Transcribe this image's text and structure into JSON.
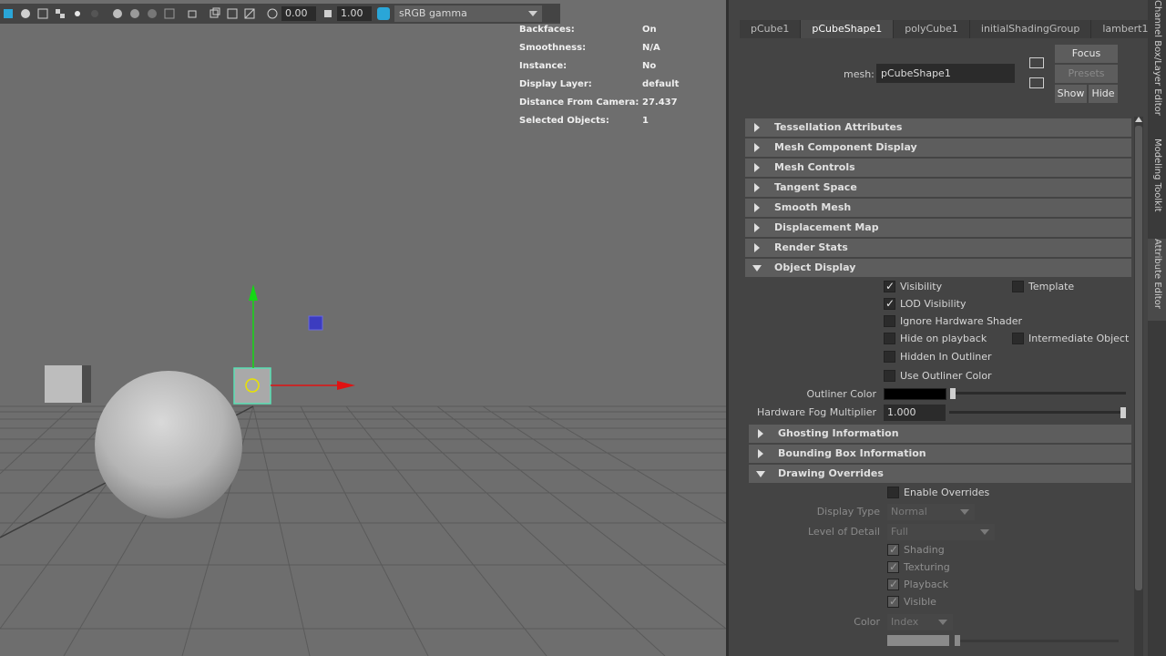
{
  "toolbar": {
    "exposure_value": "0.00",
    "gamma_value": "1.00",
    "color_space": "sRGB gamma",
    "icons": [
      "cube-icon",
      "shading-icon",
      "wireframe-icon",
      "checker-icon",
      "light-icon",
      "sphere-icon",
      "isolate-icon",
      "xray-icon",
      "grid-icon",
      "camera-icon",
      "lens-icon",
      "exposure-icon",
      "gamma-icon",
      "color-management-icon"
    ]
  },
  "hud": [
    {
      "key": "Backfaces:",
      "value": "On"
    },
    {
      "key": "Smoothness:",
      "value": "N/A"
    },
    {
      "key": "Instance:",
      "value": "No"
    },
    {
      "key": "Display Layer:",
      "value": "default"
    },
    {
      "key": "Distance From Camera:",
      "value": "27.437"
    },
    {
      "key": "Selected Objects:",
      "value": "1"
    }
  ],
  "attribute_editor": {
    "tabs": [
      "pCube1",
      "pCubeShape1",
      "polyCube1",
      "initialShadingGroup",
      "lambert1"
    ],
    "active_tab": "pCubeShape1",
    "mesh_label": "mesh:",
    "mesh_value": "pCubeShape1",
    "buttons": {
      "focus": "Focus",
      "presets": "Presets",
      "show": "Show",
      "hide": "Hide"
    },
    "sections_collapsed": [
      "Tessellation Attributes",
      "Mesh Component Display",
      "Mesh Controls",
      "Tangent Space",
      "Smooth Mesh",
      "Displacement Map",
      "Render Stats"
    ],
    "object_display": {
      "title": "Object Display",
      "visibility": {
        "label": "Visibility",
        "checked": true
      },
      "template": {
        "label": "Template",
        "checked": false
      },
      "lod_visibility": {
        "label": "LOD Visibility",
        "checked": true
      },
      "ignore_hw_shader": {
        "label": "Ignore Hardware Shader",
        "checked": false
      },
      "hide_on_playback": {
        "label": "Hide on playback",
        "checked": false
      },
      "intermediate_object": {
        "label": "Intermediate Object",
        "checked": false
      },
      "hidden_in_outliner": {
        "label": "Hidden In Outliner",
        "checked": false
      },
      "use_outliner_color": {
        "label": "Use Outliner Color",
        "checked": false
      },
      "outliner_color_label": "Outliner Color",
      "outliner_color": "#000000",
      "fog_label": "Hardware Fog Multiplier",
      "fog_value": "1.000"
    },
    "ghosting": "Ghosting Information",
    "bounding_box": "Bounding Box Information",
    "drawing_overrides": {
      "title": "Drawing Overrides",
      "enable_overrides": {
        "label": "Enable Overrides",
        "checked": false
      },
      "display_type_label": "Display Type",
      "display_type_value": "Normal",
      "level_of_detail_label": "Level of Detail",
      "level_of_detail_value": "Full",
      "shading": {
        "label": "Shading",
        "checked": true
      },
      "texturing": {
        "label": "Texturing",
        "checked": true
      },
      "playback": {
        "label": "Playback",
        "checked": true
      },
      "visible": {
        "label": "Visible",
        "checked": true
      },
      "color_label": "Color",
      "color_value": "Index"
    }
  },
  "side_tabs": [
    "Channel Box/Layer Editor",
    "Modeling Toolkit",
    "Attribute Editor"
  ],
  "active_side_tab": "Attribute Editor"
}
